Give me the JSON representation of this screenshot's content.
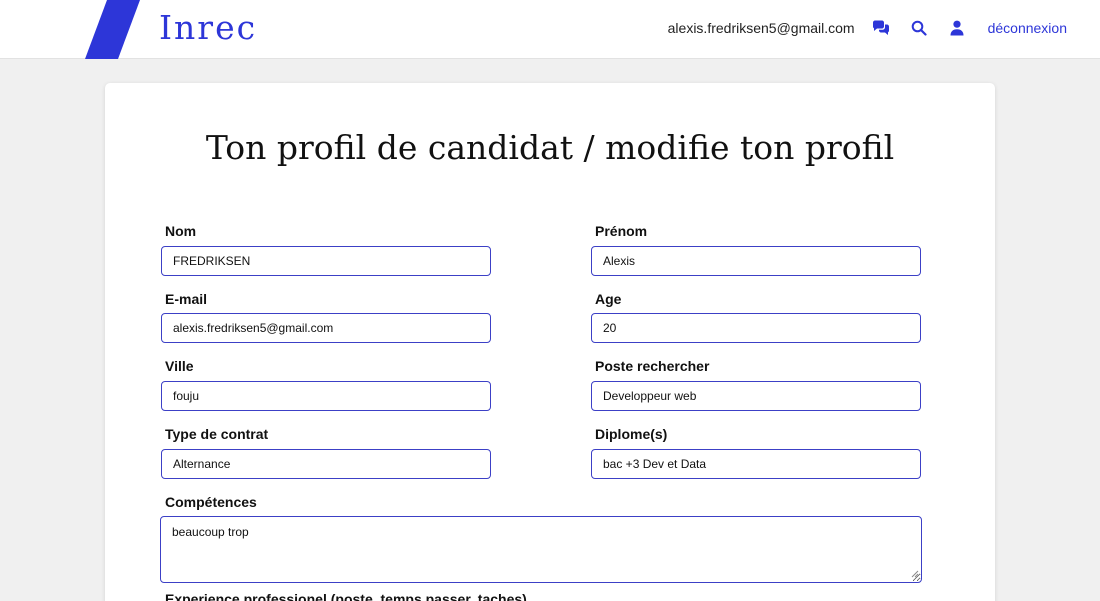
{
  "header": {
    "brand": "Inrec",
    "user_email": "alexis.fredriksen5@gmail.com",
    "logout_label": "déconnexion",
    "accent_color": "#2d36d8",
    "icons": [
      "messages-icon",
      "search-icon",
      "user-icon"
    ]
  },
  "page": {
    "title": "Ton profil de candidat / modifie ton profil"
  },
  "form": {
    "nom": {
      "label": "Nom",
      "value": "FREDRIKSEN"
    },
    "prenom": {
      "label": "Prénom",
      "value": "Alexis"
    },
    "email": {
      "label": "E-mail",
      "value": "alexis.fredriksen5@gmail.com"
    },
    "age": {
      "label": "Age",
      "value": "20"
    },
    "ville": {
      "label": "Ville",
      "value": "fouju"
    },
    "poste": {
      "label": "Poste rechercher",
      "value": "Developpeur web"
    },
    "contrat": {
      "label": "Type de contrat",
      "value": "Alternance"
    },
    "diplome": {
      "label": "Diplome(s)",
      "value": "bac +3 Dev et Data"
    },
    "competences": {
      "label": "Compétences",
      "value": "beaucoup trop"
    },
    "experience": {
      "label": "Experience professionel (poste, temps passer, taches)"
    }
  }
}
